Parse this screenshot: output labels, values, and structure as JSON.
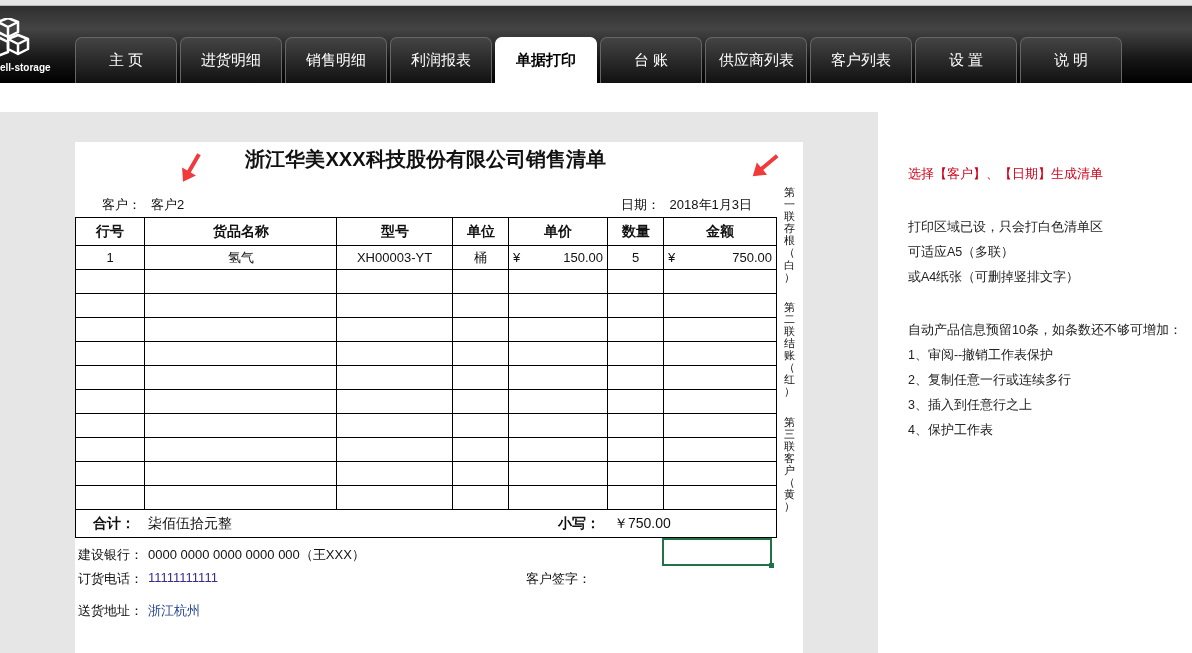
{
  "logo": {
    "text": "ell-storage"
  },
  "tabs": [
    {
      "label": "主 页",
      "selected": false
    },
    {
      "label": "进货明细",
      "selected": false
    },
    {
      "label": "销售明细",
      "selected": false
    },
    {
      "label": "利润报表",
      "selected": false
    },
    {
      "label": "单据打印",
      "selected": true
    },
    {
      "label": "台 账",
      "selected": false
    },
    {
      "label": "供应商列表",
      "selected": false
    },
    {
      "label": "客户列表",
      "selected": false
    },
    {
      "label": "设 置",
      "selected": false
    },
    {
      "label": "说 明",
      "selected": false
    }
  ],
  "document": {
    "title": "浙江华美XXX科技股份有限公司销售清单",
    "customer_label": "客户：",
    "customer": "客户2",
    "date_label": "日期：",
    "date": "2018年1月3日",
    "columns": [
      "行号",
      "货品名称",
      "型号",
      "单位",
      "单价",
      "数量",
      "金额"
    ],
    "rows": [
      {
        "no": "1",
        "name": "氢气",
        "model": "XH00003-YT",
        "unit": "桶",
        "price_currency": "¥",
        "price": "150.00",
        "qty": "5",
        "amount_currency": "¥",
        "amount": "750.00"
      }
    ],
    "total": {
      "label": "合计：",
      "in_words": "柒佰伍拾元整",
      "figure_label": "小写：",
      "figure": "￥750.00"
    },
    "bank_label": "建设银行：",
    "bank": "0000 0000 0000 0000 000（王XXX）",
    "phone_label": "订货电话：",
    "phone": "11111111111",
    "signature_label": "客户签字：",
    "address_label": "送货地址：",
    "address": "浙江杭州",
    "copies": [
      "第一联存根（白）",
      "第二联结账（红）",
      "第三联客户（黄）"
    ]
  },
  "note_groups": [
    {
      "lines": [
        {
          "text": "选择【客户】、【日期】生成清单",
          "kind": "warning"
        }
      ]
    },
    {
      "lines": [
        {
          "text": "打印区域已设，只会打白色清单区",
          "kind": "plain"
        },
        {
          "text": "可适应A5（多联）",
          "kind": "plain"
        },
        {
          "text": "或A4纸张（可删掉竖排文字）",
          "kind": "plain"
        }
      ]
    },
    {
      "lines": [
        {
          "text": "自动产品信息预留10条，如条数还不够可增加：",
          "kind": "plain"
        },
        {
          "text": "1、审阅--撤销工作表保护",
          "kind": "plain"
        },
        {
          "text": "2、复制任意一行或连续多行",
          "kind": "plain"
        },
        {
          "text": "3、插入到任意行之上",
          "kind": "plain"
        },
        {
          "text": "4、保护工作表",
          "kind": "plain"
        }
      ]
    }
  ]
}
